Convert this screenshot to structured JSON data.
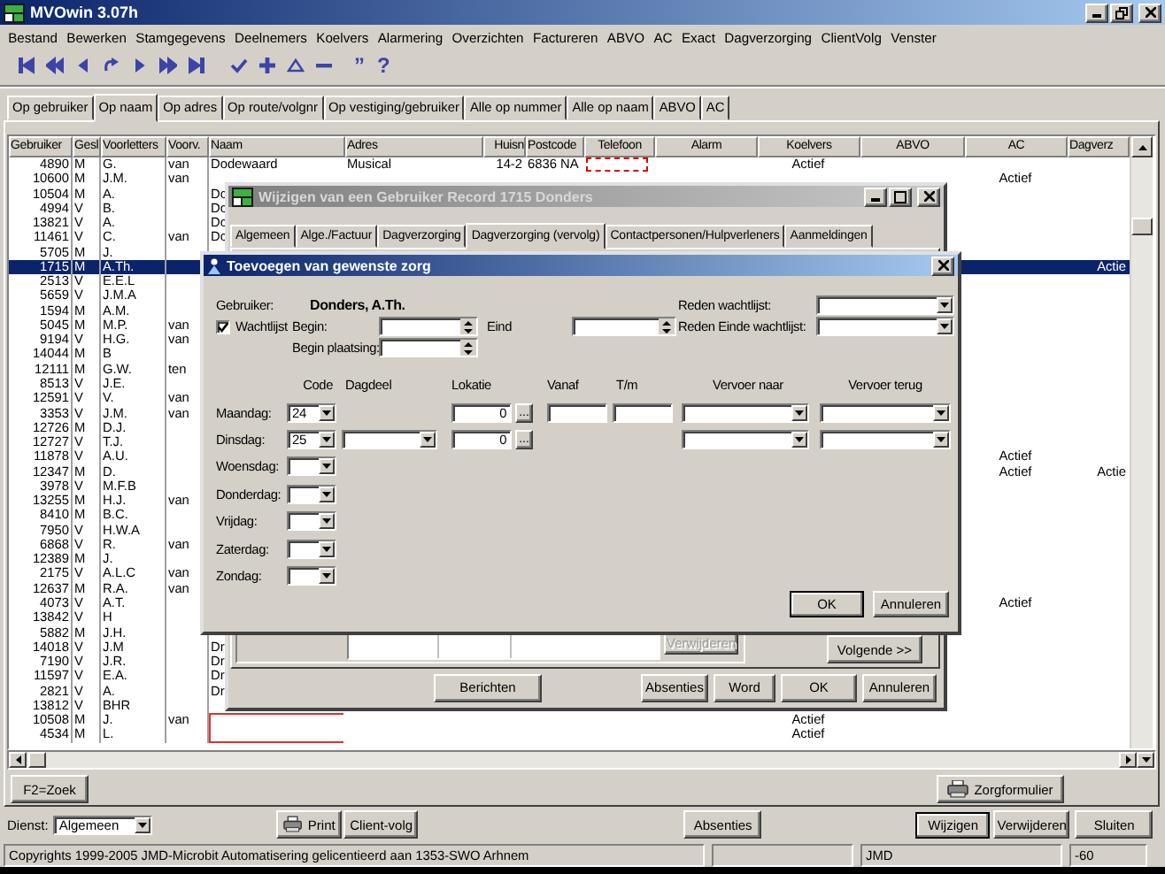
{
  "window": {
    "title": "MVOwin 3.07h"
  },
  "menu": [
    "Bestand",
    "Bewerken",
    "Stamgegevens",
    "Deelnemers",
    "Koelvers",
    "Alarmering",
    "Overzichten",
    "Factureren",
    "ABVO",
    "AC",
    "Exact",
    "Dagverzorging",
    "ClientVolg",
    "Venster"
  ],
  "toolbar": {
    "quote": "”",
    "help": "?"
  },
  "tabs": [
    {
      "label": "Op gebruiker",
      "selected": false
    },
    {
      "label": "Op naam",
      "selected": true
    },
    {
      "label": "Op  adres",
      "selected": false
    },
    {
      "label": "Op route/volgnr",
      "selected": false
    },
    {
      "label": "Op vestiging/gebruiker",
      "selected": false
    },
    {
      "label": "Alle op nummer",
      "selected": false
    },
    {
      "label": "Alle op naam",
      "selected": false
    },
    {
      "label": "ABVO",
      "selected": false
    },
    {
      "label": "AC",
      "selected": false
    }
  ],
  "table": {
    "columns": [
      "Gebruiker",
      "Gesl",
      "Voorletters",
      "Voorv.",
      "Naam",
      "Adres",
      "Huisn",
      "Postcode",
      "Telefoon",
      "Alarm",
      "Koelvers",
      "ABVO",
      "AC",
      "Dagverz"
    ],
    "rows": [
      {
        "gebruiker": "4890",
        "gesl": "M",
        "voorletters": "G.",
        "voorv": "van",
        "naam": "Dodewaard",
        "adres": "Musical",
        "huisn": "14-2",
        "postcode": "6836 NA",
        "koelvers": "Actief",
        "selected": false,
        "flagged": true,
        "outlined": false
      },
      {
        "gebruiker": "10600",
        "gesl": "M",
        "voorletters": "J.M.",
        "voorv": "van",
        "ac": "Actief",
        "selected": false,
        "flagged": false,
        "outlined": false
      },
      {
        "gebruiker": "10504",
        "gesl": "M",
        "voorletters": "A.",
        "naam": "Dc",
        "selected": false,
        "flagged": false,
        "outlined": false
      },
      {
        "gebruiker": "4994",
        "gesl": "V",
        "voorletters": "B.",
        "naam": "Dc",
        "selected": false,
        "flagged": false,
        "outlined": false
      },
      {
        "gebruiker": "13821",
        "gesl": "V",
        "voorletters": "A.",
        "naam": "Dc",
        "selected": false,
        "flagged": false,
        "outlined": false
      },
      {
        "gebruiker": "11461",
        "gesl": "V",
        "voorletters": "C.",
        "voorv": "van",
        "naam": "Dc",
        "selected": false,
        "flagged": false,
        "outlined": false
      },
      {
        "gebruiker": "5705",
        "gesl": "M",
        "voorletters": "J.",
        "selected": false,
        "flagged": false,
        "outlined": false
      },
      {
        "gebruiker": "1715",
        "gesl": "M",
        "voorletters": "A.Th.",
        "dagverz": "Actie",
        "selected": true,
        "flagged": false,
        "outlined": false
      },
      {
        "gebruiker": "2513",
        "gesl": "V",
        "voorletters": "E.E.L",
        "selected": false,
        "flagged": false,
        "outlined": false
      },
      {
        "gebruiker": "5659",
        "gesl": "V",
        "voorletters": "J.M.A",
        "selected": false,
        "flagged": false,
        "outlined": false
      },
      {
        "gebruiker": "1594",
        "gesl": "M",
        "voorletters": "A.M.",
        "selected": false,
        "flagged": false,
        "outlined": false
      },
      {
        "gebruiker": "5045",
        "gesl": "M",
        "voorletters": "M.P.",
        "voorv": "van",
        "selected": false,
        "flagged": false,
        "outlined": false
      },
      {
        "gebruiker": "9194",
        "gesl": "V",
        "voorletters": "H.G.",
        "voorv": "van",
        "selected": false,
        "flagged": false,
        "outlined": false
      },
      {
        "gebruiker": "14044",
        "gesl": "M",
        "voorletters": "B",
        "selected": false,
        "flagged": false,
        "outlined": false
      },
      {
        "gebruiker": "12111",
        "gesl": "M",
        "voorletters": "G.W.",
        "voorv": "ten",
        "selected": false,
        "flagged": false,
        "outlined": false
      },
      {
        "gebruiker": "8513",
        "gesl": "V",
        "voorletters": "J.E.",
        "selected": false,
        "flagged": false,
        "outlined": false
      },
      {
        "gebruiker": "12591",
        "gesl": "V",
        "voorletters": "V.",
        "voorv": "van",
        "selected": false,
        "flagged": false,
        "outlined": false
      },
      {
        "gebruiker": "3353",
        "gesl": "V",
        "voorletters": "J.M.",
        "voorv": "van",
        "selected": false,
        "flagged": false,
        "outlined": false
      },
      {
        "gebruiker": "12726",
        "gesl": "M",
        "voorletters": "D.J.",
        "selected": false,
        "flagged": false,
        "outlined": false
      },
      {
        "gebruiker": "12727",
        "gesl": "V",
        "voorletters": "T.J.",
        "selected": false,
        "flagged": false,
        "outlined": false
      },
      {
        "gebruiker": "11878",
        "gesl": "V",
        "voorletters": "A.U.",
        "ac": "Actief",
        "selected": false,
        "flagged": false,
        "outlined": false
      },
      {
        "gebruiker": "12347",
        "gesl": "M",
        "voorletters": "D.",
        "ac": "Actief",
        "dagverz": "Actie",
        "selected": false,
        "flagged": false,
        "outlined": false
      },
      {
        "gebruiker": "3978",
        "gesl": "V",
        "voorletters": "M.F.B",
        "selected": false,
        "flagged": false,
        "outlined": false
      },
      {
        "gebruiker": "13255",
        "gesl": "M",
        "voorletters": "H.J.",
        "voorv": "van",
        "selected": false,
        "flagged": false,
        "outlined": false
      },
      {
        "gebruiker": "8410",
        "gesl": "M",
        "voorletters": "B.C.",
        "selected": false,
        "flagged": false,
        "outlined": false
      },
      {
        "gebruiker": "7950",
        "gesl": "V",
        "voorletters": "H.W.A",
        "selected": false,
        "flagged": false,
        "outlined": false
      },
      {
        "gebruiker": "6868",
        "gesl": "V",
        "voorletters": "R.",
        "voorv": "van",
        "selected": false,
        "flagged": false,
        "outlined": false
      },
      {
        "gebruiker": "12389",
        "gesl": "M",
        "voorletters": "J.",
        "selected": false,
        "flagged": false,
        "outlined": false
      },
      {
        "gebruiker": "2175",
        "gesl": "V",
        "voorletters": "A.L.C",
        "voorv": "van",
        "selected": false,
        "flagged": false,
        "outlined": false
      },
      {
        "gebruiker": "12637",
        "gesl": "M",
        "voorletters": "R.A.",
        "voorv": "van",
        "selected": false,
        "flagged": false,
        "outlined": false
      },
      {
        "gebruiker": "4073",
        "gesl": "V",
        "voorletters": "A.T.",
        "ac": "Actief",
        "selected": false,
        "flagged": false,
        "outlined": false
      },
      {
        "gebruiker": "13842",
        "gesl": "V",
        "voorletters": "H",
        "selected": false,
        "flagged": false,
        "outlined": false
      },
      {
        "gebruiker": "5882",
        "gesl": "M",
        "voorletters": "J.H.",
        "selected": false,
        "flagged": false,
        "outlined": false
      },
      {
        "gebruiker": "14018",
        "gesl": "V",
        "voorletters": "J.M",
        "naam": "Dr",
        "selected": false,
        "flagged": false,
        "outlined": false
      },
      {
        "gebruiker": "7190",
        "gesl": "V",
        "voorletters": "J.R.",
        "naam": "Dr",
        "selected": false,
        "flagged": false,
        "outlined": false
      },
      {
        "gebruiker": "11597",
        "gesl": "V",
        "voorletters": "E.A.",
        "naam": "Dr",
        "selected": false,
        "flagged": false,
        "outlined": false
      },
      {
        "gebruiker": "2821",
        "gesl": "V",
        "voorletters": "A.",
        "naam": "Dr",
        "selected": false,
        "flagged": false,
        "outlined": false
      },
      {
        "gebruiker": "13812",
        "gesl": "V",
        "voorletters": "BHR",
        "selected": false,
        "flagged": false,
        "outlined": false
      },
      {
        "gebruiker": "10508",
        "gesl": "M",
        "voorletters": "J.",
        "voorv": "van",
        "koelvers": "Actief",
        "selected": false,
        "flagged": false,
        "outlined": true
      },
      {
        "gebruiker": "4534",
        "gesl": "M",
        "voorletters": "L.",
        "koelvers": "Actief",
        "selected": false,
        "flagged": false,
        "outlined": true
      }
    ]
  },
  "panel_buttons": {
    "search": "F2=Zoek",
    "form": "Zorgformulier"
  },
  "record_dialog": {
    "title": "Wijzigen van een Gebruiker Record 1715 Donders",
    "tabs": [
      {
        "label": "Algemeen",
        "selected": false
      },
      {
        "label": "Alge./Factuur",
        "selected": false
      },
      {
        "label": "Dagverzorging",
        "selected": false
      },
      {
        "label": "Dagverzorging (vervolg)",
        "selected": true
      },
      {
        "label": "Contactpersonen/Hulpverleners",
        "selected": false
      },
      {
        "label": "Aanmeldingen",
        "selected": false
      }
    ],
    "remove_button": {
      "label": "Verwijderen",
      "disabled": true
    },
    "next_button": "Volgende >>",
    "buttons": [
      "Berichten",
      "Absenties",
      "Word",
      "OK",
      "Annuleren"
    ]
  },
  "care_dialog": {
    "title": "Toevoegen van gewenste zorg",
    "user_label": "Gebruiker:",
    "user_name": "Donders, A.Th.",
    "waitlist": {
      "label": "Wachtlijst",
      "checked": true
    },
    "begin_label": "Begin:",
    "end_label": "Eind",
    "placement_label": "Begin plaatsing:",
    "reason_label": "Reden wachtlijst:",
    "reason_end_label": "Reden Einde wachtlijst:",
    "columns": [
      "Code",
      "Dagdeel",
      "Lokatie",
      "Vanaf",
      "T/m",
      "Vervoer naar",
      "Vervoer terug"
    ],
    "days": [
      {
        "label": "Maandag:",
        "kind": "full",
        "code": "24",
        "lokatie": "0",
        "browse": "..."
      },
      {
        "label": "Dinsdag:",
        "kind": "partial",
        "code": "25",
        "lokatie": "0",
        "browse": "..."
      },
      {
        "label": "Woensdag:",
        "kind": "code"
      },
      {
        "label": "Donderdag:",
        "kind": "code"
      },
      {
        "label": "Vrijdag:",
        "kind": "code"
      },
      {
        "label": "Zaterdag:",
        "kind": "code"
      },
      {
        "label": "Zondag:",
        "kind": "code"
      }
    ],
    "buttons": [
      "OK",
      "Annuleren"
    ]
  },
  "footer": {
    "dienst_label": "Dienst:",
    "dienst_value": "Algemeen",
    "print": "Print",
    "client": "Client-volg",
    "absences": "Absenties",
    "edit": "Wijzigen",
    "remove": "Verwijderen",
    "close": "Sluiten"
  },
  "status_bar": {
    "copyright": "Copyrights 1999-2005 JMD-Microbit Automatisering gelicentieerd aan 1353-SWO Arhnem",
    "user": "JMD",
    "code": "-60"
  }
}
